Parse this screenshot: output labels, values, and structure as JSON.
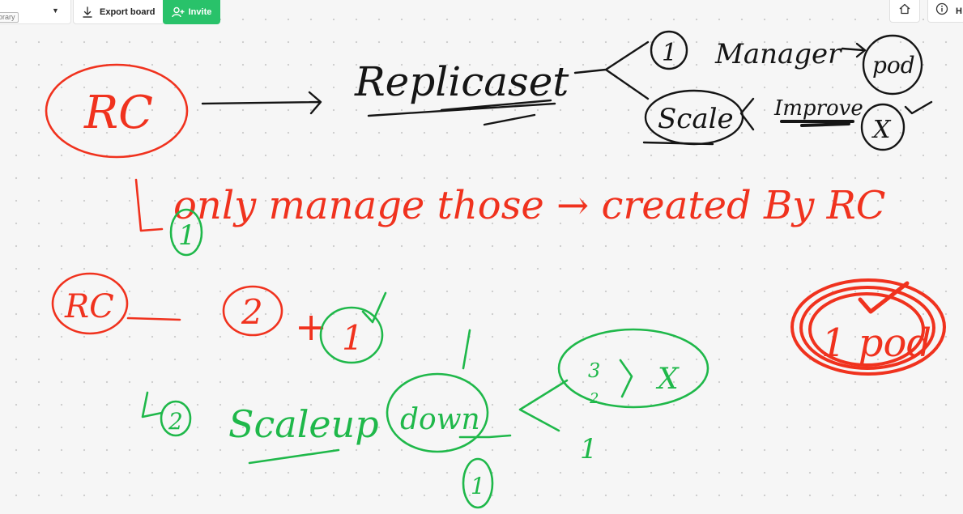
{
  "toolbar": {
    "library_badge": "orary",
    "export_label": "Export board",
    "invite_label": "Invite",
    "help_label": "H"
  },
  "icons": {
    "caret": "chevron-down-icon",
    "export": "download-icon",
    "invite": "add-user-icon",
    "home": "home-icon",
    "help": "info-icon"
  },
  "colors": {
    "accent_green": "#29c26a",
    "ink_red": "#f0321e",
    "ink_green": "#1fb84a",
    "ink_black": "#151515"
  },
  "board": {
    "rc_top": "RC",
    "replicaset": "Replicaset",
    "one_circle": "1",
    "manager": "Manager",
    "pod_top": "pod",
    "scale": "Scale",
    "improve": "Improve",
    "x_circle": "X",
    "only_manage_line": "only manage those → created By RC",
    "green_one": "1",
    "rc_mid": "RC",
    "two": "2",
    "plus": "+",
    "one_green": "1",
    "two_green": "2",
    "scaleup": "Scaleup",
    "down": "down",
    "three": "3",
    "two_small": "2",
    "x_small": "X",
    "one_small": "1",
    "one_bottom": "1",
    "pod_right": "1 pod"
  }
}
